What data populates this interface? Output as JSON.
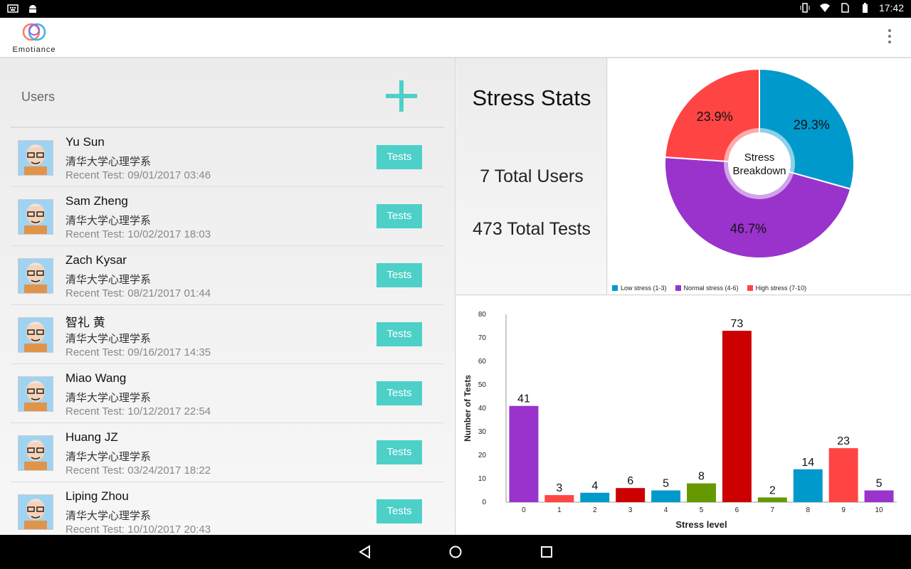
{
  "status_bar": {
    "time": "17:42",
    "icons": [
      "keyboard-icon",
      "android-icon",
      "vibrate-icon",
      "wifi-icon",
      "no-sim-icon",
      "battery-icon"
    ]
  },
  "app": {
    "logo_text": "Emotiance",
    "overflow_icon": "more-vert-icon"
  },
  "users_panel": {
    "title": "Users",
    "add_icon": "plus-icon",
    "users": [
      {
        "name": "Yu Sun",
        "dept": "清华大学心理学系",
        "recent": "Recent Test: 09/01/2017 03:46",
        "button": "Tests"
      },
      {
        "name": "Sam Zheng",
        "dept": "清华大学心理学系",
        "recent": "Recent Test: 10/02/2017 18:03",
        "button": "Tests"
      },
      {
        "name": "Zach Kysar",
        "dept": "清华大学心理学系",
        "recent": "Recent Test: 08/21/2017 01:44",
        "button": "Tests"
      },
      {
        "name": "智礼 黄",
        "dept": "清华大学心理学系",
        "recent": "Recent Test: 09/16/2017 14:35",
        "button": "Tests"
      },
      {
        "name": "Miao Wang",
        "dept": "清华大学心理学系",
        "recent": "Recent Test: 10/12/2017 22:54",
        "button": "Tests"
      },
      {
        "name": "Huang JZ",
        "dept": "清华大学心理学系",
        "recent": "Recent Test: 03/24/2017 18:22",
        "button": "Tests"
      },
      {
        "name": "Liping Zhou",
        "dept": "清华大学心理学系",
        "recent": "Recent Test: 10/10/2017 20:43",
        "button": "Tests"
      }
    ]
  },
  "stats": {
    "title": "Stress Stats",
    "total_users": "7 Total Users",
    "total_tests": "473 Total Tests"
  },
  "colors": {
    "accent": "#4cd0c8",
    "low": "#0099cc",
    "normal": "#9933cc",
    "high": "#ff4444",
    "dark_red": "#cc0000",
    "green": "#669900"
  },
  "chart_data": [
    {
      "type": "pie",
      "center_label": "Stress\nBreakdown",
      "slices": [
        {
          "label": "Low stress (1-3)",
          "value": 29.3,
          "display": "29.3%",
          "color": "#0099cc"
        },
        {
          "label": "Normal stress (4-6)",
          "value": 46.7,
          "display": "46.7%",
          "color": "#9933cc"
        },
        {
          "label": "High stress (7-10)",
          "value": 23.9,
          "display": "23.9%",
          "color": "#ff4444"
        }
      ],
      "legend_position": "bottom-left"
    },
    {
      "type": "bar",
      "xlabel": "Stress level",
      "ylabel": "Number of Tests",
      "categories": [
        "0",
        "1",
        "2",
        "3",
        "4",
        "5",
        "6",
        "7",
        "8",
        "9",
        "10"
      ],
      "values": [
        41,
        3,
        4,
        6,
        5,
        8,
        73,
        2,
        14,
        23,
        5
      ],
      "colors": [
        "#9933cc",
        "#ff4444",
        "#0099cc",
        "#cc0000",
        "#0099cc",
        "#669900",
        "#cc0000",
        "#669900",
        "#0099cc",
        "#ff4444",
        "#9933cc"
      ],
      "ylim": [
        0,
        80
      ],
      "yticks": [
        0,
        10,
        20,
        30,
        40,
        50,
        60,
        70,
        80
      ],
      "grid": false
    }
  ],
  "nav": {
    "back_icon": "back-icon",
    "home_icon": "home-icon",
    "recents_icon": "recents-icon"
  }
}
